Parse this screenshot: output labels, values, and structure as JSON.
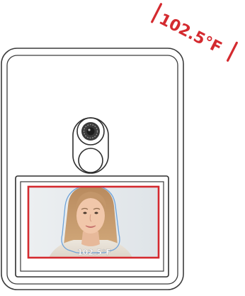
{
  "alert": {
    "temperature": "102.5°F",
    "color": "#d42a2f"
  },
  "screen": {
    "temperature": "102.5°F",
    "frame_color": "#d42a2f",
    "face_outline_color": "#6fa3d8"
  },
  "icons": {
    "camera": "camera-lens-icon",
    "sensor": "sensor-icon",
    "face": "face-photo"
  }
}
